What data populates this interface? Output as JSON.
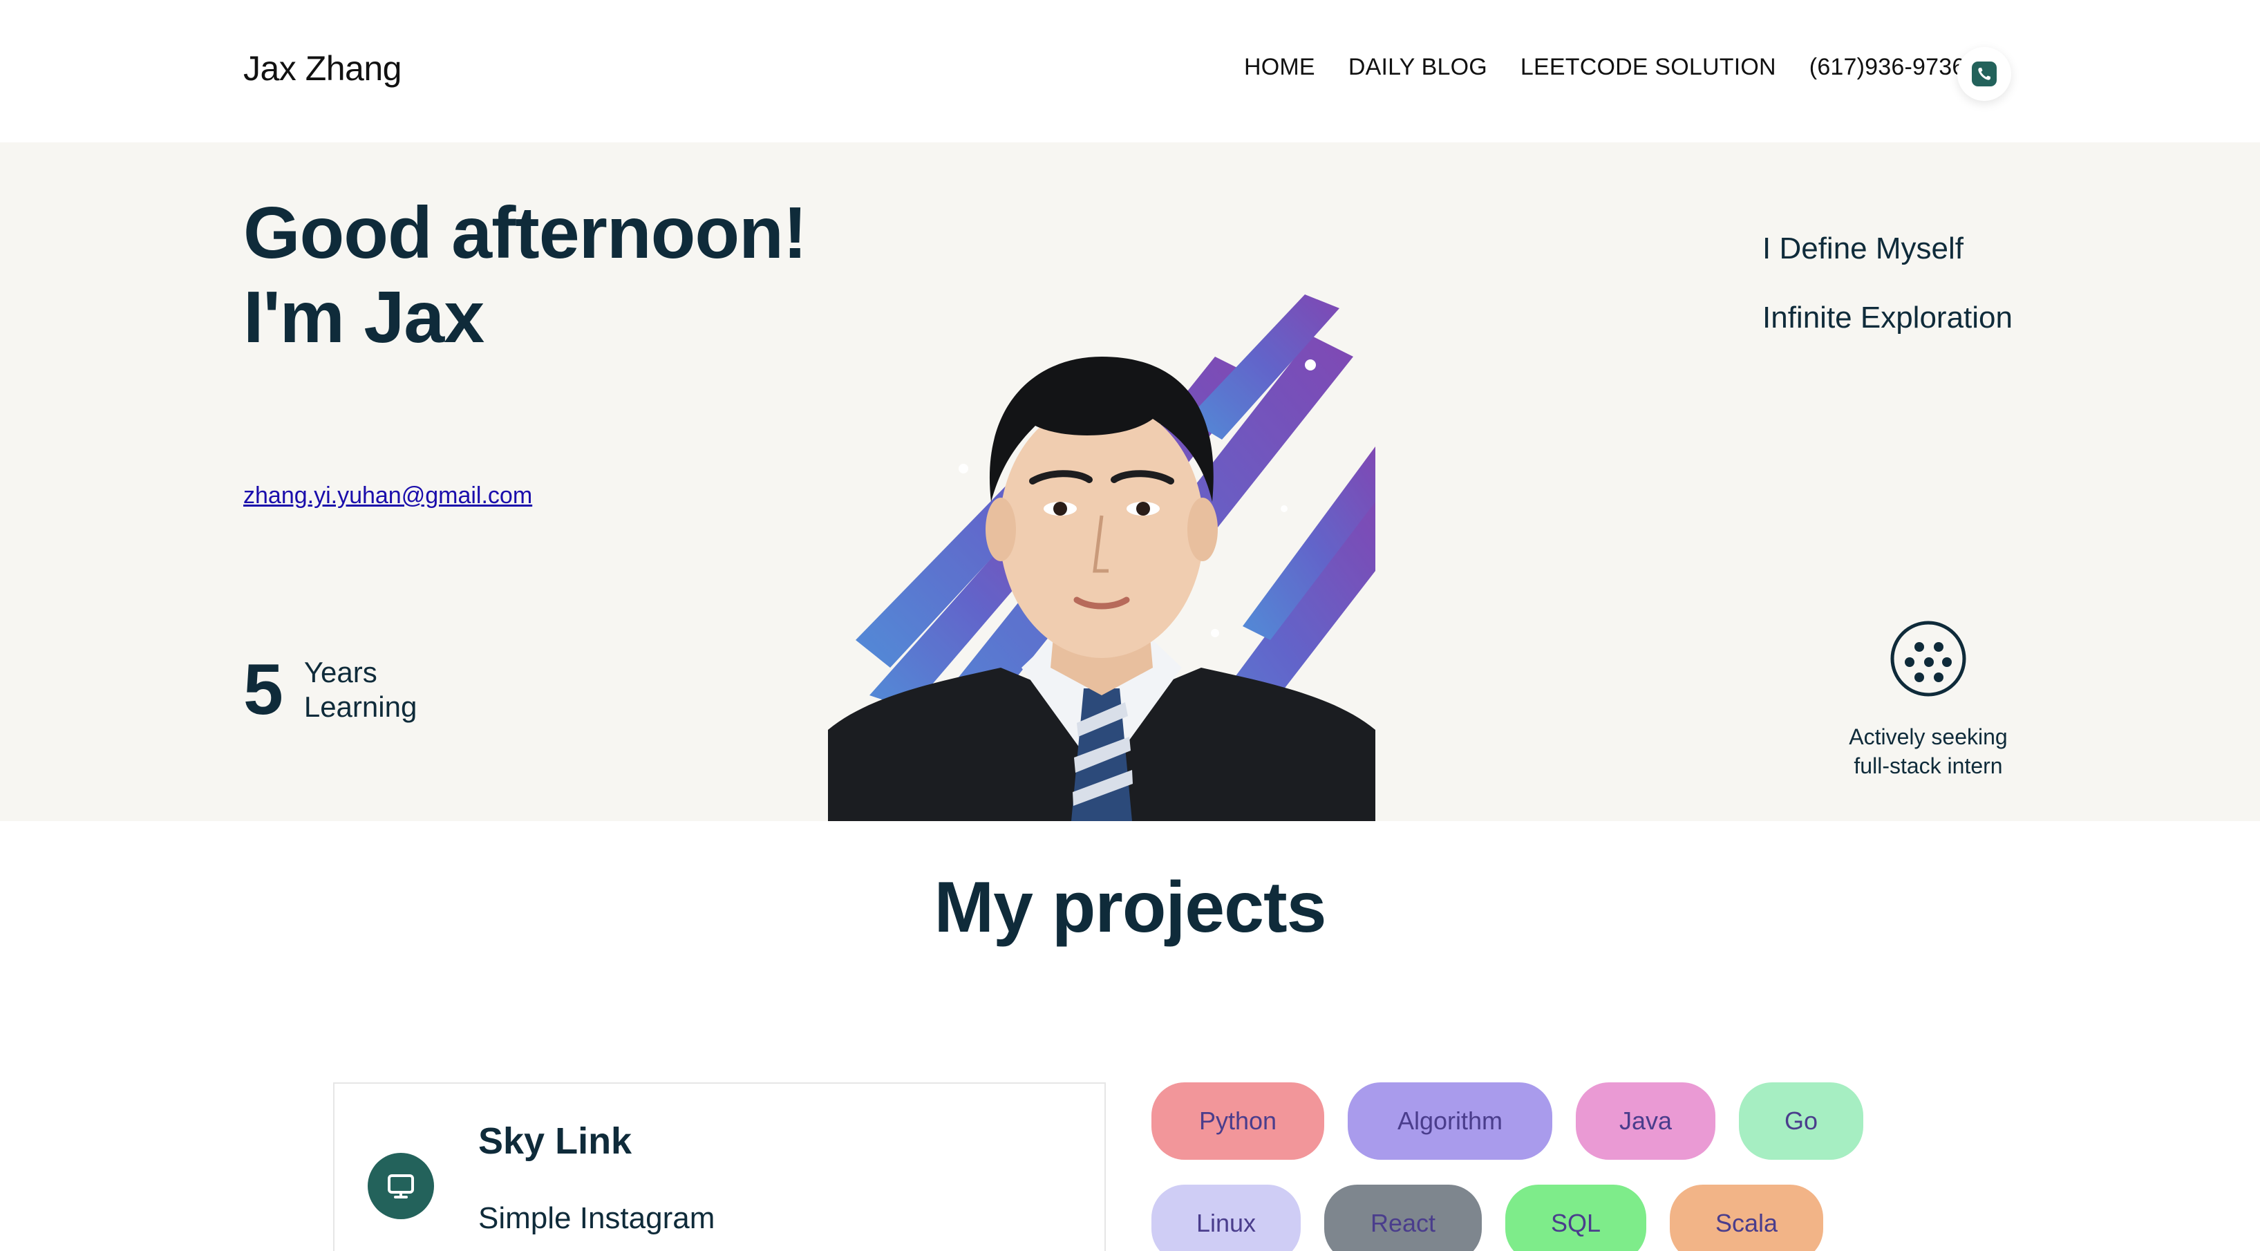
{
  "header": {
    "brand": "Jax Zhang",
    "nav": [
      "HOME",
      "DAILY BLOG",
      "LEETCODE SOLUTION",
      "(617)936-9736"
    ],
    "phone_icon": "phone-icon",
    "accent": "#23625b"
  },
  "hero": {
    "greeting_line1": "Good afternoon!",
    "greeting_line2": "I'm Jax",
    "email": "zhang.yi.yuhan@gmail.com",
    "years_number": "5",
    "years_line1": "Years",
    "years_line2": "Learning",
    "taglines": [
      "I Define Myself",
      "Infinite Exploration"
    ],
    "seek_line1": "Actively seeking",
    "seek_line2": "full-stack intern",
    "bg_color": "#f7f6f2"
  },
  "projects": {
    "title": "My projects",
    "card": {
      "name": "Sky Link",
      "description": "Simple Instagram",
      "icon": "monitor-icon"
    },
    "tags": [
      {
        "label": "Python",
        "color": "#f2969a"
      },
      {
        "label": "Algorithm",
        "color": "#a99bec"
      },
      {
        "label": "Java",
        "color": "#ea9ad4"
      },
      {
        "label": "Go",
        "color": "#a6eec2"
      },
      {
        "label": "Linux",
        "color": "#cfcdf5"
      },
      {
        "label": "React",
        "color": "#7e868e"
      },
      {
        "label": "SQL",
        "color": "#7eec8a"
      },
      {
        "label": "Scala",
        "color": "#f2b487"
      }
    ]
  }
}
